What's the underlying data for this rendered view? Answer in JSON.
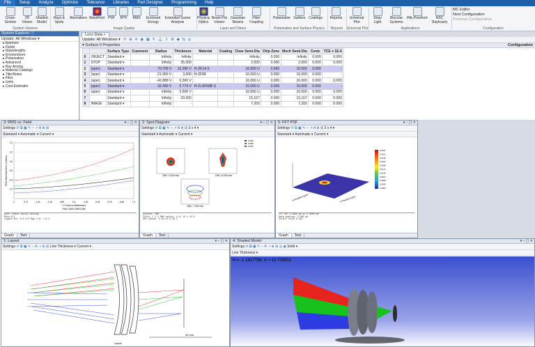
{
  "menubar": [
    "File",
    "Setup",
    "Analyze",
    "Optimize",
    "Tolerance",
    "Libraries",
    "Part Designer",
    "Programming",
    "Help"
  ],
  "ribbon": {
    "buttons": [
      "Cross-Section",
      "3D Viewer",
      "Shaded Model",
      "Rays & Spots",
      "Aberrations",
      "Wavefront",
      "PSF",
      "MTF",
      "RMS",
      "Enclosed Energy",
      "Extended Scene Analysis",
      "Physical Optics",
      "Beam File Viewer",
      "Gaussian Beams",
      "Fiber Coupling",
      "Polarization",
      "Surface",
      "Coatings",
      "Reports",
      "Universal Plot",
      "Stray Light",
      "Biocular Systems",
      "PAL/Freeform",
      "NSC Raytracing"
    ],
    "groups": [
      "System Viewers",
      "Image Quality",
      "Laser and Fibers",
      "Polarization and Surface Physics",
      "Reports",
      "Universal Plot",
      "Applications",
      "Configuration"
    ],
    "config_items": [
      "MC Editor",
      "Next Configuration",
      "Previous Configuration"
    ]
  },
  "explorer": {
    "title": "System Explorer ⓘ",
    "update": "Update: All Windows ▾",
    "items": [
      "Aperture",
      "Fields",
      "Wavelengths",
      "Environment",
      "Polarization",
      "Advanced",
      "Ray Aiming",
      "Material Catalogs",
      "Title/Notes",
      "Files",
      "Units",
      "Cost Estimator"
    ]
  },
  "lens": {
    "tab": "Lens Data ×",
    "toolbar": "Update: All Windows ▾",
    "surface_props": "Surface 0 Properties",
    "configuration": "Configuration",
    "headers": [
      "",
      "Surface Type",
      "Comment",
      "Radius",
      "Thickness",
      "Material",
      "Coating",
      "Clear Semi-Dia",
      "Chip Zone",
      "Mech Semi-Dia",
      "Conic",
      "TCE x 1E-6"
    ],
    "rows": [
      [
        "0",
        "OBJECT",
        "Standard ▾",
        "",
        "Infinity",
        "Infinity",
        "",
        "",
        "Infinity",
        "0.000",
        "Infinity",
        "0.000",
        "0.000"
      ],
      [
        "1",
        "STOP",
        "Standard ▾",
        "",
        "Infinity",
        "35.000",
        "",
        "",
        "2.000",
        "0.000",
        "2.000",
        "0.000",
        "0.000"
      ],
      [
        "2",
        "(aper)",
        "Standard ▾",
        "",
        "70.799  V",
        "10.395  V",
        "H-ZK14  S",
        "",
        "16.000  U",
        "0.000",
        "16.000",
        "0.000",
        "-"
      ],
      [
        "3",
        "(aper)",
        "Standard ▾",
        "",
        "-21.065  V",
        "3.000",
        "H-ZF88",
        "",
        "16.000  U",
        "0.000",
        "16.000",
        "0.000",
        "-"
      ],
      [
        "4",
        "(aper)",
        "Standard ▾",
        "",
        "-42.888  V",
        "0.300  V",
        "",
        "",
        "16.000  U",
        "0.000",
        "16.000",
        "0.000",
        "0.000"
      ],
      [
        "5",
        "(aper)",
        "Standard ▾",
        "",
        "32.490  V",
        "5.774  V",
        "H-ZLAF68B  S",
        "",
        "16.000  U",
        "0.000",
        "16.000",
        "0.000",
        "-"
      ],
      [
        "6",
        "(aper)",
        "Standard ▾",
        "",
        "Infinity",
        "0.500  V",
        "",
        "",
        "16.000  U",
        "0.000",
        "16.000",
        "0.000",
        "0.000"
      ],
      [
        "7",
        "",
        "Standard ▾",
        "",
        "Infinity",
        "20.000",
        "",
        "",
        "15.167",
        "0.000",
        "15.167",
        "0.000",
        "0.000"
      ],
      [
        "8",
        "IMAGE",
        "Standard ▾",
        "",
        "Infinity",
        "-",
        "",
        "",
        "7.200",
        "0.000",
        "7.200",
        "0.000",
        "0.000"
      ]
    ]
  },
  "win_rms": {
    "title": "3: RMS vs. Field",
    "settings": "Settings",
    "dropdowns": "Standard ▾  Automatic ▾  Current ▾",
    "xlabel": "+Y Field in Millimeters",
    "ylabel": "RMS Wavefront Error in Waves",
    "legend": "Poly  0.486  0.588  0.656",
    "xticks": [
      "0",
      "0.72",
      "1.44",
      "2.16",
      "2.88",
      "3.6",
      "4.32",
      "5.04",
      "5.76",
      "6.48",
      "7.2"
    ],
    "yticks": [
      "0.2",
      "0.4",
      "0.6",
      "0.8",
      "1.0",
      "1.2"
    ],
    "tabs": [
      "Graph",
      "Text"
    ]
  },
  "win_spot": {
    "title": "2: Spot Diagram",
    "settings": "Settings",
    "grid": "3 x 4 ▾",
    "dropdowns": "Standard ▾  Automatic ▾  Current ▾",
    "labels": [
      "OBJ: 0.000 mm",
      "OBJ: 5.000 mm",
      "OBJ: 7.200 mm"
    ],
    "legend": [
      "0.486",
      "0.588",
      "0.656"
    ],
    "tabs": [
      "Graph",
      "Text"
    ]
  },
  "win_fft": {
    "title": "5: FFT PSF",
    "settings": "Settings",
    "grid": "3 x 4 ▾",
    "dropdowns": "Standard ▾  Automatic ▾  Current ▾",
    "colorbar": [
      "0.0347",
      "0.0313",
      "0.0278",
      "0.0243",
      "0.0208",
      "0.0174",
      "0.0139",
      "0.0104",
      "0.0069",
      "0.0035",
      "0.0000"
    ],
    "xaxis": "Y-Position (µm)",
    "yaxis": "X-Position (µm)",
    "tabs": [
      "Graph",
      "Text"
    ]
  },
  "win_layout": {
    "title": "1: Layout",
    "settings": "Settings",
    "dropdowns": "Line Thickness ▾  Current ▾",
    "scale": "40 mm",
    "caption": "Layout"
  },
  "win_shaded": {
    "title": "4: Shaded Model",
    "settings": "Settings",
    "dropdowns": "Solid ▾",
    "line": "Line Thickness ▾",
    "readout": "H = -1.1417786, V = 13.705001"
  },
  "colors": {
    "menubar": "#1d5fa8",
    "sel_row": "#c9c9ef",
    "shaded_top": "#3a4fd0",
    "shaded_bottom": "#ffffff"
  }
}
